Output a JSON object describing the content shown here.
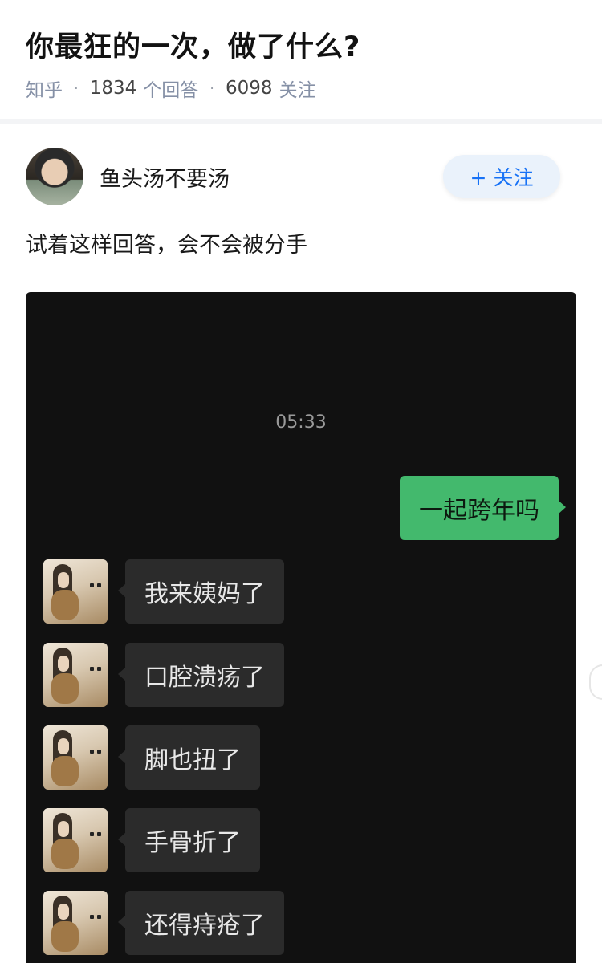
{
  "question": {
    "title": "你最狂的一次，做了什么?",
    "source": "知乎",
    "answer_count": "1834",
    "answer_label": "个回答",
    "follower_count": "6098",
    "follower_label": "关注"
  },
  "answer": {
    "author_name": "鱼头汤不要汤",
    "follow_label": "+ 关注",
    "text": "试着这样回答，会不会被分手"
  },
  "chat": {
    "time": "05:33",
    "sent_message": "一起跨年吗",
    "received_messages": [
      "我来姨妈了",
      "口腔溃疡了",
      "脚也扭了",
      "手骨折了",
      "还得痔疮了"
    ]
  },
  "colors": {
    "sent_bubble": "#43b96d",
    "received_bubble": "#2b2b2b",
    "chat_background": "#111111",
    "accent": "#1772f6"
  },
  "icons": {
    "author_avatar": "avatar",
    "chat_avatar": "girl-holding-bear-avatar"
  }
}
